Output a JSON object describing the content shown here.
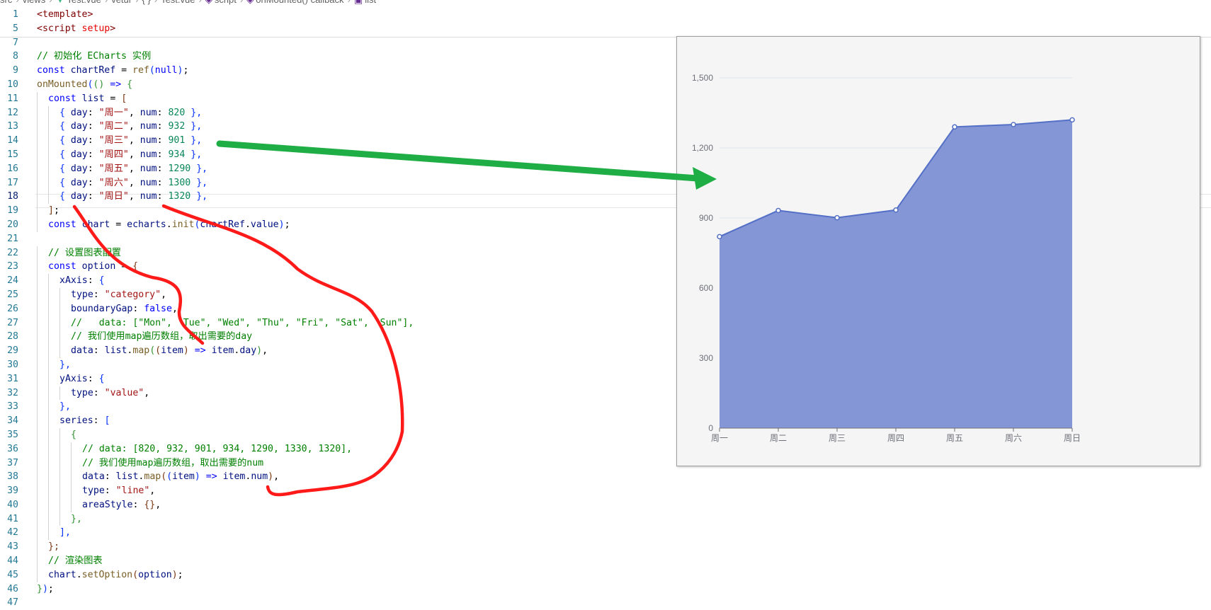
{
  "breadcrumb": [
    "src",
    "views",
    "Test.vue",
    "vetur",
    "{ }",
    "Test.vue",
    "script",
    "onMounted() callback",
    "list"
  ],
  "editor": {
    "active_line": 18,
    "lines": [
      {
        "n": "1",
        "i": 0,
        "t": [
          [
            "<template>",
            "tag"
          ]
        ]
      },
      {
        "n": "5",
        "i": 0,
        "t": [
          [
            "<script ",
            "tag"
          ],
          [
            "setup",
            "attr"
          ],
          [
            ">",
            "tag"
          ]
        ]
      },
      {
        "n": "7",
        "i": 0,
        "t": []
      },
      {
        "n": "8",
        "i": 0,
        "t": [
          [
            "// 初始化 ECharts 实例",
            "cmt"
          ]
        ]
      },
      {
        "n": "9",
        "i": 0,
        "t": [
          [
            "const ",
            "kw"
          ],
          [
            "chartRef",
            "var"
          ],
          [
            " = ",
            "txt"
          ],
          [
            "ref",
            "fn"
          ],
          [
            "(",
            "br1"
          ],
          [
            "null",
            "kw"
          ],
          [
            ")",
            "br1"
          ],
          [
            ";",
            "txt"
          ]
        ]
      },
      {
        "n": "10",
        "i": 0,
        "t": [
          [
            "onMounted",
            "fn"
          ],
          [
            "(",
            "br1"
          ],
          [
            "()",
            "br2"
          ],
          [
            " => ",
            "kw"
          ],
          [
            "{",
            "br2"
          ]
        ]
      },
      {
        "n": "11",
        "i": 1,
        "t": [
          [
            "const ",
            "kw"
          ],
          [
            "list",
            "var"
          ],
          [
            " = ",
            "txt"
          ],
          [
            "[",
            "br3"
          ]
        ]
      },
      {
        "n": "12",
        "i": 2,
        "t": [
          [
            "{ ",
            "br1"
          ],
          [
            "day",
            "var"
          ],
          [
            ": ",
            "txt"
          ],
          [
            "\"周一\"",
            "str"
          ],
          [
            ", ",
            "txt"
          ],
          [
            "num",
            "var"
          ],
          [
            ": ",
            "txt"
          ],
          [
            "820",
            "num"
          ],
          [
            " },",
            "br1"
          ]
        ]
      },
      {
        "n": "13",
        "i": 2,
        "t": [
          [
            "{ ",
            "br1"
          ],
          [
            "day",
            "var"
          ],
          [
            ": ",
            "txt"
          ],
          [
            "\"周二\"",
            "str"
          ],
          [
            ", ",
            "txt"
          ],
          [
            "num",
            "var"
          ],
          [
            ": ",
            "txt"
          ],
          [
            "932",
            "num"
          ],
          [
            " },",
            "br1"
          ]
        ]
      },
      {
        "n": "14",
        "i": 2,
        "t": [
          [
            "{ ",
            "br1"
          ],
          [
            "day",
            "var"
          ],
          [
            ": ",
            "txt"
          ],
          [
            "\"周三\"",
            "str"
          ],
          [
            ", ",
            "txt"
          ],
          [
            "num",
            "var"
          ],
          [
            ": ",
            "txt"
          ],
          [
            "901",
            "num"
          ],
          [
            " },",
            "br1"
          ]
        ]
      },
      {
        "n": "15",
        "i": 2,
        "t": [
          [
            "{ ",
            "br1"
          ],
          [
            "day",
            "var"
          ],
          [
            ": ",
            "txt"
          ],
          [
            "\"周四\"",
            "str"
          ],
          [
            ", ",
            "txt"
          ],
          [
            "num",
            "var"
          ],
          [
            ": ",
            "txt"
          ],
          [
            "934",
            "num"
          ],
          [
            " },",
            "br1"
          ]
        ]
      },
      {
        "n": "16",
        "i": 2,
        "t": [
          [
            "{ ",
            "br1"
          ],
          [
            "day",
            "var"
          ],
          [
            ": ",
            "txt"
          ],
          [
            "\"周五\"",
            "str"
          ],
          [
            ", ",
            "txt"
          ],
          [
            "num",
            "var"
          ],
          [
            ": ",
            "txt"
          ],
          [
            "1290",
            "num"
          ],
          [
            " },",
            "br1"
          ]
        ]
      },
      {
        "n": "17",
        "i": 2,
        "t": [
          [
            "{ ",
            "br1"
          ],
          [
            "day",
            "var"
          ],
          [
            ": ",
            "txt"
          ],
          [
            "\"周六\"",
            "str"
          ],
          [
            ", ",
            "txt"
          ],
          [
            "num",
            "var"
          ],
          [
            ": ",
            "txt"
          ],
          [
            "1300",
            "num"
          ],
          [
            " },",
            "br1"
          ]
        ]
      },
      {
        "n": "18",
        "i": 2,
        "t": [
          [
            "{ ",
            "br1"
          ],
          [
            "day",
            "var"
          ],
          [
            ": ",
            "txt"
          ],
          [
            "\"周日\"",
            "str"
          ],
          [
            ", ",
            "txt"
          ],
          [
            "num",
            "var"
          ],
          [
            ": ",
            "txt"
          ],
          [
            "1320",
            "num"
          ],
          [
            " },",
            "br1"
          ]
        ]
      },
      {
        "n": "19",
        "i": 1,
        "t": [
          [
            "]",
            "br3"
          ],
          [
            ";",
            "txt"
          ]
        ]
      },
      {
        "n": "20",
        "i": 1,
        "t": [
          [
            "const ",
            "kw"
          ],
          [
            "chart",
            "var"
          ],
          [
            " = ",
            "txt"
          ],
          [
            "echarts",
            "var"
          ],
          [
            ".",
            "txt"
          ],
          [
            "init",
            "fn"
          ],
          [
            "(",
            "br1"
          ],
          [
            "chartRef",
            "var"
          ],
          [
            ".",
            "txt"
          ],
          [
            "value",
            "var"
          ],
          [
            ")",
            "br1"
          ],
          [
            ";",
            "txt"
          ]
        ]
      },
      {
        "n": "21",
        "i": 0,
        "t": []
      },
      {
        "n": "22",
        "i": 1,
        "t": [
          [
            "// 设置图表配置",
            "cmt"
          ]
        ]
      },
      {
        "n": "23",
        "i": 1,
        "t": [
          [
            "const ",
            "kw"
          ],
          [
            "option",
            "var"
          ],
          [
            " = ",
            "txt"
          ],
          [
            "{",
            "br3"
          ]
        ]
      },
      {
        "n": "24",
        "i": 2,
        "t": [
          [
            "xAxis",
            "var"
          ],
          [
            ": ",
            "txt"
          ],
          [
            "{",
            "br1"
          ]
        ]
      },
      {
        "n": "25",
        "i": 3,
        "t": [
          [
            "type",
            "var"
          ],
          [
            ": ",
            "txt"
          ],
          [
            "\"category\"",
            "str"
          ],
          [
            ",",
            "txt"
          ]
        ]
      },
      {
        "n": "26",
        "i": 3,
        "t": [
          [
            "boundaryGap",
            "var"
          ],
          [
            ": ",
            "txt"
          ],
          [
            "false",
            "kw"
          ],
          [
            ",",
            "txt"
          ]
        ]
      },
      {
        "n": "27",
        "i": 3,
        "t": [
          [
            "//   data: [\"Mon\", \"Tue\", \"Wed\", \"Thu\", \"Fri\", \"Sat\", \"Sun\"],",
            "cmt"
          ]
        ]
      },
      {
        "n": "28",
        "i": 3,
        "t": [
          [
            "// 我们使用map遍历数组，取出需要的day",
            "cmt"
          ]
        ]
      },
      {
        "n": "29",
        "i": 3,
        "t": [
          [
            "data",
            "var"
          ],
          [
            ": ",
            "txt"
          ],
          [
            "list",
            "var"
          ],
          [
            ".",
            "txt"
          ],
          [
            "map",
            "fn"
          ],
          [
            "(",
            "br2"
          ],
          [
            "(",
            "br3"
          ],
          [
            "item",
            "var"
          ],
          [
            ")",
            "br3"
          ],
          [
            " => ",
            "kw"
          ],
          [
            "item",
            "var"
          ],
          [
            ".",
            "txt"
          ],
          [
            "day",
            "var"
          ],
          [
            ")",
            "br2"
          ],
          [
            ",",
            "txt"
          ]
        ]
      },
      {
        "n": "30",
        "i": 2,
        "t": [
          [
            "},",
            "br1"
          ]
        ]
      },
      {
        "n": "31",
        "i": 2,
        "t": [
          [
            "yAxis",
            "var"
          ],
          [
            ": ",
            "txt"
          ],
          [
            "{",
            "br1"
          ]
        ]
      },
      {
        "n": "32",
        "i": 3,
        "t": [
          [
            "type",
            "var"
          ],
          [
            ": ",
            "txt"
          ],
          [
            "\"value\"",
            "str"
          ],
          [
            ",",
            "txt"
          ]
        ]
      },
      {
        "n": "33",
        "i": 2,
        "t": [
          [
            "},",
            "br1"
          ]
        ]
      },
      {
        "n": "34",
        "i": 2,
        "t": [
          [
            "series",
            "var"
          ],
          [
            ": ",
            "txt"
          ],
          [
            "[",
            "br1"
          ]
        ]
      },
      {
        "n": "35",
        "i": 3,
        "t": [
          [
            "{",
            "br2"
          ]
        ]
      },
      {
        "n": "36",
        "i": 4,
        "t": [
          [
            "// data: [820, 932, 901, 934, 1290, 1330, 1320],",
            "cmt"
          ]
        ]
      },
      {
        "n": "37",
        "i": 4,
        "t": [
          [
            "// 我们使用map遍历数组，取出需要的num",
            "cmt"
          ]
        ]
      },
      {
        "n": "38",
        "i": 4,
        "t": [
          [
            "data",
            "var"
          ],
          [
            ": ",
            "txt"
          ],
          [
            "list",
            "var"
          ],
          [
            ".",
            "txt"
          ],
          [
            "map",
            "fn"
          ],
          [
            "(",
            "br3"
          ],
          [
            "(",
            "br1"
          ],
          [
            "item",
            "var"
          ],
          [
            ")",
            "br1"
          ],
          [
            " => ",
            "kw"
          ],
          [
            "item",
            "var"
          ],
          [
            ".",
            "txt"
          ],
          [
            "num",
            "var"
          ],
          [
            ")",
            "br3"
          ],
          [
            ",",
            "txt"
          ]
        ]
      },
      {
        "n": "39",
        "i": 4,
        "t": [
          [
            "type",
            "var"
          ],
          [
            ": ",
            "txt"
          ],
          [
            "\"line\"",
            "str"
          ],
          [
            ",",
            "txt"
          ]
        ]
      },
      {
        "n": "40",
        "i": 4,
        "t": [
          [
            "areaStyle",
            "var"
          ],
          [
            ": ",
            "txt"
          ],
          [
            "{}",
            "br3"
          ],
          [
            ",",
            "txt"
          ]
        ]
      },
      {
        "n": "41",
        "i": 3,
        "t": [
          [
            "},",
            "br2"
          ]
        ]
      },
      {
        "n": "42",
        "i": 2,
        "t": [
          [
            "],",
            "br1"
          ]
        ]
      },
      {
        "n": "43",
        "i": 1,
        "t": [
          [
            "};",
            "br3"
          ]
        ]
      },
      {
        "n": "44",
        "i": 1,
        "t": [
          [
            "// 渲染图表",
            "cmt"
          ]
        ]
      },
      {
        "n": "45",
        "i": 1,
        "t": [
          [
            "chart",
            "var"
          ],
          [
            ".",
            "txt"
          ],
          [
            "setOption",
            "fn"
          ],
          [
            "(",
            "br3"
          ],
          [
            "option",
            "var"
          ],
          [
            ")",
            "br3"
          ],
          [
            ";",
            "txt"
          ]
        ]
      },
      {
        "n": "46",
        "i": 0,
        "t": [
          [
            "}",
            "br2"
          ],
          [
            ")",
            "br1"
          ],
          [
            ";",
            "txt"
          ]
        ]
      },
      {
        "n": "47",
        "i": 0,
        "t": []
      }
    ]
  },
  "colors": {
    "area_fill": "#8596d6",
    "area_line": "#5470c6",
    "arrow": "#1fad45",
    "annotation": "#ff1a1a",
    "axis_label": "#6e7079"
  },
  "chart_data": {
    "type": "area",
    "categories": [
      "周一",
      "周二",
      "周三",
      "周四",
      "周五",
      "周六",
      "周日"
    ],
    "series": [
      {
        "values": [
          820,
          932,
          901,
          934,
          1290,
          1300,
          1320
        ]
      }
    ],
    "y_ticks": [
      "0",
      "300",
      "600",
      "900",
      "1,200",
      "1,500"
    ],
    "ylim": [
      0,
      1500
    ],
    "grid": true,
    "smooth": false
  }
}
